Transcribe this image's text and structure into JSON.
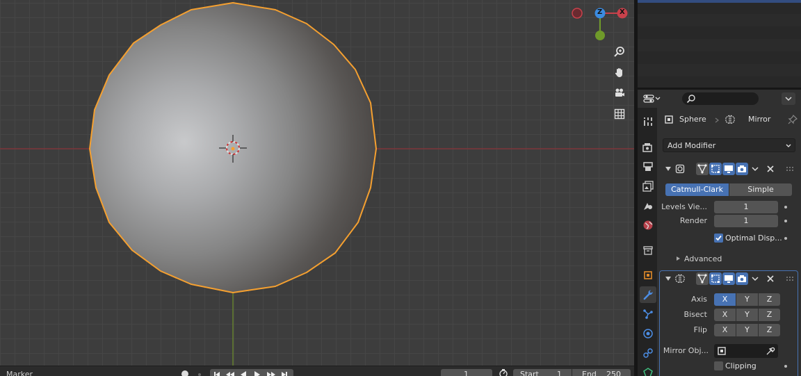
{
  "viewport": {
    "gizmo": {
      "z_label": "Z",
      "x_label": "X"
    },
    "nav_tools": [
      "zoom-icon",
      "hand-pan-icon",
      "camera-icon",
      "grid-icon"
    ]
  },
  "properties": {
    "breadcrumb": {
      "object": "Sphere",
      "modifier": "Mirror"
    },
    "add_modifier_label": "Add Modifier",
    "subsurf": {
      "catmull_clark": "Catmull-Clark",
      "simple": "Simple",
      "levels_viewport_label": "Levels Vie...",
      "levels_viewport_value": "1",
      "render_label": "Render",
      "render_value": "1",
      "optimal_display_label": "Optimal Disp...",
      "optimal_display_checked": true,
      "advanced_label": "Advanced"
    },
    "mirror": {
      "axis_label": "Axis",
      "bisect_label": "Bisect",
      "flip_label": "Flip",
      "x": "X",
      "y": "Y",
      "z": "Z",
      "mirror_object_label": "Mirror Obj...",
      "clipping_label": "Clipping"
    }
  },
  "timeline": {
    "marker_label": "Marker",
    "current_frame": "1",
    "start_label": "Start",
    "start_value": "1",
    "end_label": "End",
    "end_value": "250"
  },
  "colors": {
    "accent": "#4772b3",
    "selection_outline": "#f5a030",
    "x_axis": "#a8373d",
    "y_axis": "#6f9a2a",
    "z_axis": "#3b8be0"
  }
}
